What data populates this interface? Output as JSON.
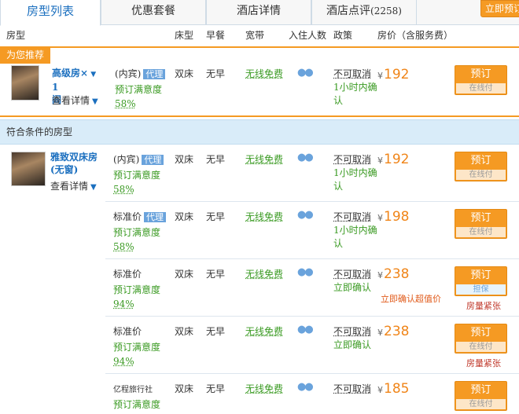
{
  "tabs": [
    {
      "label": "房型列表"
    },
    {
      "label": "优惠套餐"
    },
    {
      "label": "酒店详情"
    },
    {
      "label": "酒店点评",
      "count": "(2258)"
    }
  ],
  "book_now_label": "立即预订",
  "columns": {
    "room_type": "房型",
    "bed": "床型",
    "breakfast": "早餐",
    "broadband": "宽带",
    "occupancy": "入住人数",
    "policy": "政策",
    "price": "房价（含服务费）"
  },
  "recommended": {
    "label": "为您推荐",
    "room_name": "高级房×",
    "room_qty": "1",
    "room_unit": "间",
    "details": "查看详情",
    "rate": {
      "name": "(内宾)",
      "tag": "代理",
      "satisfaction_label": "预订满意度",
      "satisfaction": "58%",
      "bed": "双床",
      "breakfast": "无早",
      "wifi": "无线免费",
      "policy_main": "不可取消",
      "policy_sub": "1小时内确认",
      "price": "192",
      "btn": "预订",
      "btn_sub": "在线付"
    }
  },
  "section_title": "符合条件的房型",
  "room": {
    "name": "雅致双床房(无窗)",
    "details": "查看详情"
  },
  "currency": "¥",
  "rates": [
    {
      "name": "(内宾)",
      "tag": "代理",
      "satisfaction_label": "预订满意度",
      "satisfaction": "58%",
      "bed": "双床",
      "breakfast": "无早",
      "wifi": "无线免费",
      "policy_main": "不可取消",
      "policy_sub": "1小时内确认",
      "price": "192",
      "btn": "预订",
      "btn_sub": "在线付",
      "note": "",
      "btn_style": "orange"
    },
    {
      "name": "标准价",
      "tag": "代理",
      "satisfaction_label": "预订满意度",
      "satisfaction": "58%",
      "bed": "双床",
      "breakfast": "无早",
      "wifi": "无线免费",
      "policy_main": "不可取消",
      "policy_sub": "1小时内确认",
      "price": "198",
      "btn": "预订",
      "btn_sub": "在线付",
      "note": "",
      "btn_style": "orange"
    },
    {
      "name": "标准价",
      "tag": "",
      "satisfaction_label": "预订满意度",
      "satisfaction": "94%",
      "bed": "双床",
      "breakfast": "无早",
      "wifi": "无线免费",
      "policy_main": "不可取消",
      "policy_sub": "立即确认",
      "price": "238",
      "btn": "预订",
      "btn_sub": "担保",
      "note": "房量紧张",
      "promo": "立即确认超值价",
      "btn_style": "blue"
    },
    {
      "name": "标准价",
      "tag": "",
      "satisfaction_label": "预订满意度",
      "satisfaction": "94%",
      "bed": "双床",
      "breakfast": "无早",
      "wifi": "无线免费",
      "policy_main": "不可取消",
      "policy_sub": "立即确认",
      "price": "238",
      "btn": "预订",
      "btn_sub": "在线付",
      "note": "房量紧张",
      "btn_style": "orange"
    },
    {
      "name": "",
      "logo": "亿程旅行社",
      "tag": "",
      "satisfaction_label": "预订满意度",
      "satisfaction": "",
      "bed": "双床",
      "breakfast": "无早",
      "wifi": "无线免费",
      "policy_main": "不可取消",
      "policy_sub": "",
      "price": "185",
      "btn": "预订",
      "btn_sub": "在线付",
      "note": "",
      "btn_style": "orange"
    }
  ]
}
